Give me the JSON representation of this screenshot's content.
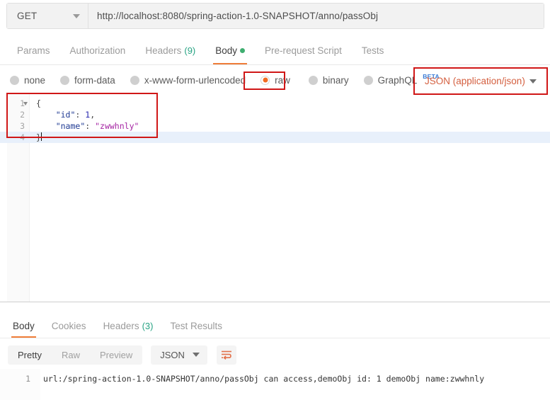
{
  "request": {
    "method": "GET",
    "url": "http://localhost:8080/spring-action-1.0-SNAPSHOT/anno/passObj",
    "tabs": [
      {
        "label": "Params",
        "active": false
      },
      {
        "label": "Authorization",
        "active": false
      },
      {
        "label": "Headers",
        "count": "(9)",
        "active": false
      },
      {
        "label": "Body",
        "active": true,
        "dot": true
      },
      {
        "label": "Pre-request Script",
        "active": false
      },
      {
        "label": "Tests",
        "active": false
      }
    ],
    "body_types": [
      {
        "label": "none",
        "selected": false
      },
      {
        "label": "form-data",
        "selected": false
      },
      {
        "label": "x-www-form-urlencoded",
        "selected": false
      },
      {
        "label": "raw",
        "selected": true
      },
      {
        "label": "binary",
        "selected": false
      },
      {
        "label": "GraphQL",
        "selected": false,
        "badge": "BETA"
      }
    ],
    "content_type": "JSON (application/json)",
    "editor": {
      "lines": [
        {
          "num": "1",
          "fold": true,
          "open_brace": "{"
        },
        {
          "num": "2",
          "key": "\"id\"",
          "colon": ": ",
          "num_val": "1",
          "comma": ","
        },
        {
          "num": "3",
          "key": "\"name\"",
          "colon": ": ",
          "str_val": "\"zwwhnly\""
        },
        {
          "num": "4",
          "close_brace": "}",
          "current": true
        }
      ]
    }
  },
  "response": {
    "tabs": [
      {
        "label": "Body",
        "active": true
      },
      {
        "label": "Cookies",
        "active": false
      },
      {
        "label": "Headers",
        "count": "(3)",
        "active": false
      },
      {
        "label": "Test Results",
        "active": false
      }
    ],
    "view_modes": [
      {
        "label": "Pretty",
        "active": true
      },
      {
        "label": "Raw",
        "active": false
      },
      {
        "label": "Preview",
        "active": false
      }
    ],
    "format": "JSON",
    "body": {
      "line_number": "1",
      "text": "url:/spring-action-1.0-SNAPSHOT/anno/passObj can access,demoObj id: 1 demoObj name:zwwhnly"
    }
  },
  "colors": {
    "accent_orange": "#ef7d38",
    "annotation_red": "#d01717",
    "green_badge": "#27a383",
    "beta_blue": "#3a7bd5",
    "content_type_text": "#d45f3f"
  }
}
